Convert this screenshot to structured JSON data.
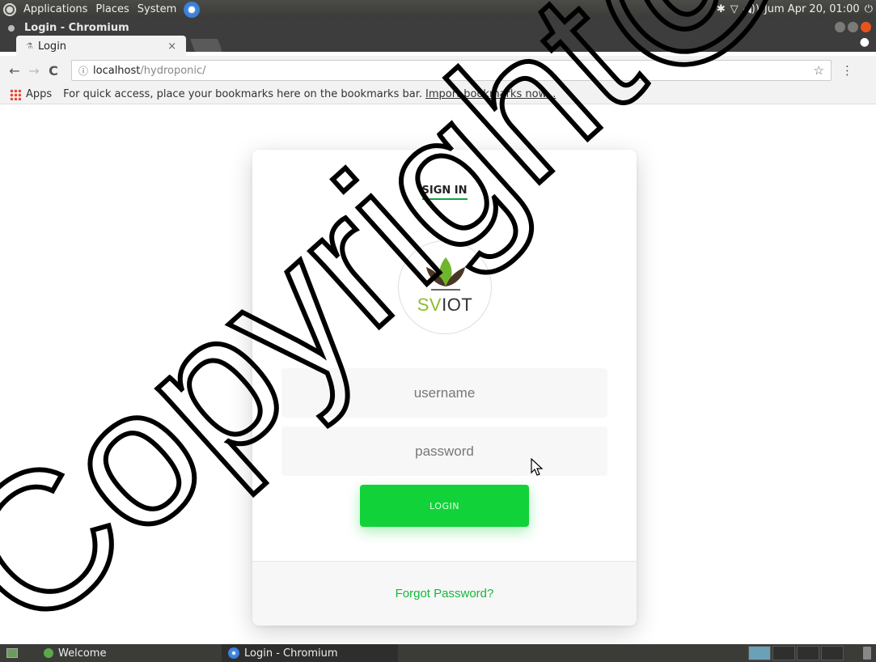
{
  "top_panel": {
    "menus": [
      "Applications",
      "Places",
      "System"
    ],
    "clock": "Jum Apr 20, 01:00",
    "bluetooth": "✱",
    "wifi": "▽",
    "volume": "◀))",
    "power": "⏻"
  },
  "window": {
    "title": "Login - Chromium"
  },
  "tab": {
    "label": "Login",
    "close": "×"
  },
  "toolbar": {
    "back": "←",
    "forward": "→",
    "reload": "C",
    "url_host": "localhost",
    "url_path": "/hydroponic/",
    "star": "☆",
    "menu": "⋮"
  },
  "bookmarks_bar": {
    "apps_label": "Apps",
    "message": "For quick access, place your bookmarks here on the bookmarks bar.",
    "import_link": "Import bookmarks now..."
  },
  "login": {
    "heading": "SIGN IN",
    "logo_text_a": "SV",
    "logo_text_b": "IOT",
    "username_placeholder": "username",
    "password_placeholder": "password",
    "button_label": "LOGIN",
    "forgot_label": "Forgot Password?"
  },
  "taskbar": {
    "task1": "Welcome",
    "task2": "Login - Chromium"
  },
  "watermark": {
    "text": "Copyright@FT"
  },
  "colors": {
    "accent_green": "#12d23a",
    "link_green": "#14b83a",
    "leaf_green": "#8cbf2c"
  }
}
